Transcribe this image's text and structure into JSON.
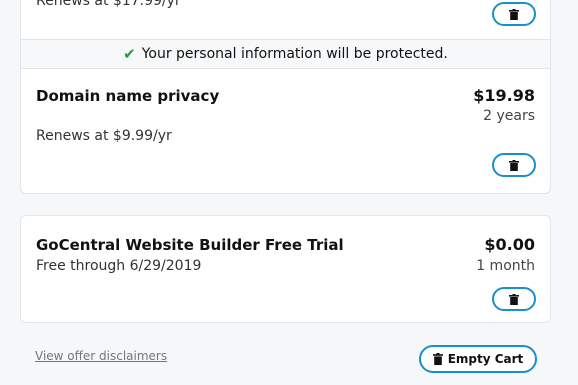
{
  "top_item": {
    "renews": "Renews at $17.99/yr"
  },
  "protection_notice": "Your personal information will be protected.",
  "privacy_item": {
    "title": "Domain name privacy",
    "price": "$19.98",
    "term": "2 years",
    "renews": "Renews at $9.99/yr"
  },
  "builder_item": {
    "title": "GoCentral Website Builder Free Trial",
    "price": "$0.00",
    "term": "1 month",
    "subtitle": "Free through 6/29/2019"
  },
  "footer": {
    "disclaimer_link": "View offer disclaimers",
    "empty_cart_label": "Empty Cart"
  },
  "colors": {
    "accent": "#1a8fc9",
    "check_green": "#1f9d3a"
  },
  "icons": [
    "trash-icon",
    "checkmark-icon"
  ]
}
